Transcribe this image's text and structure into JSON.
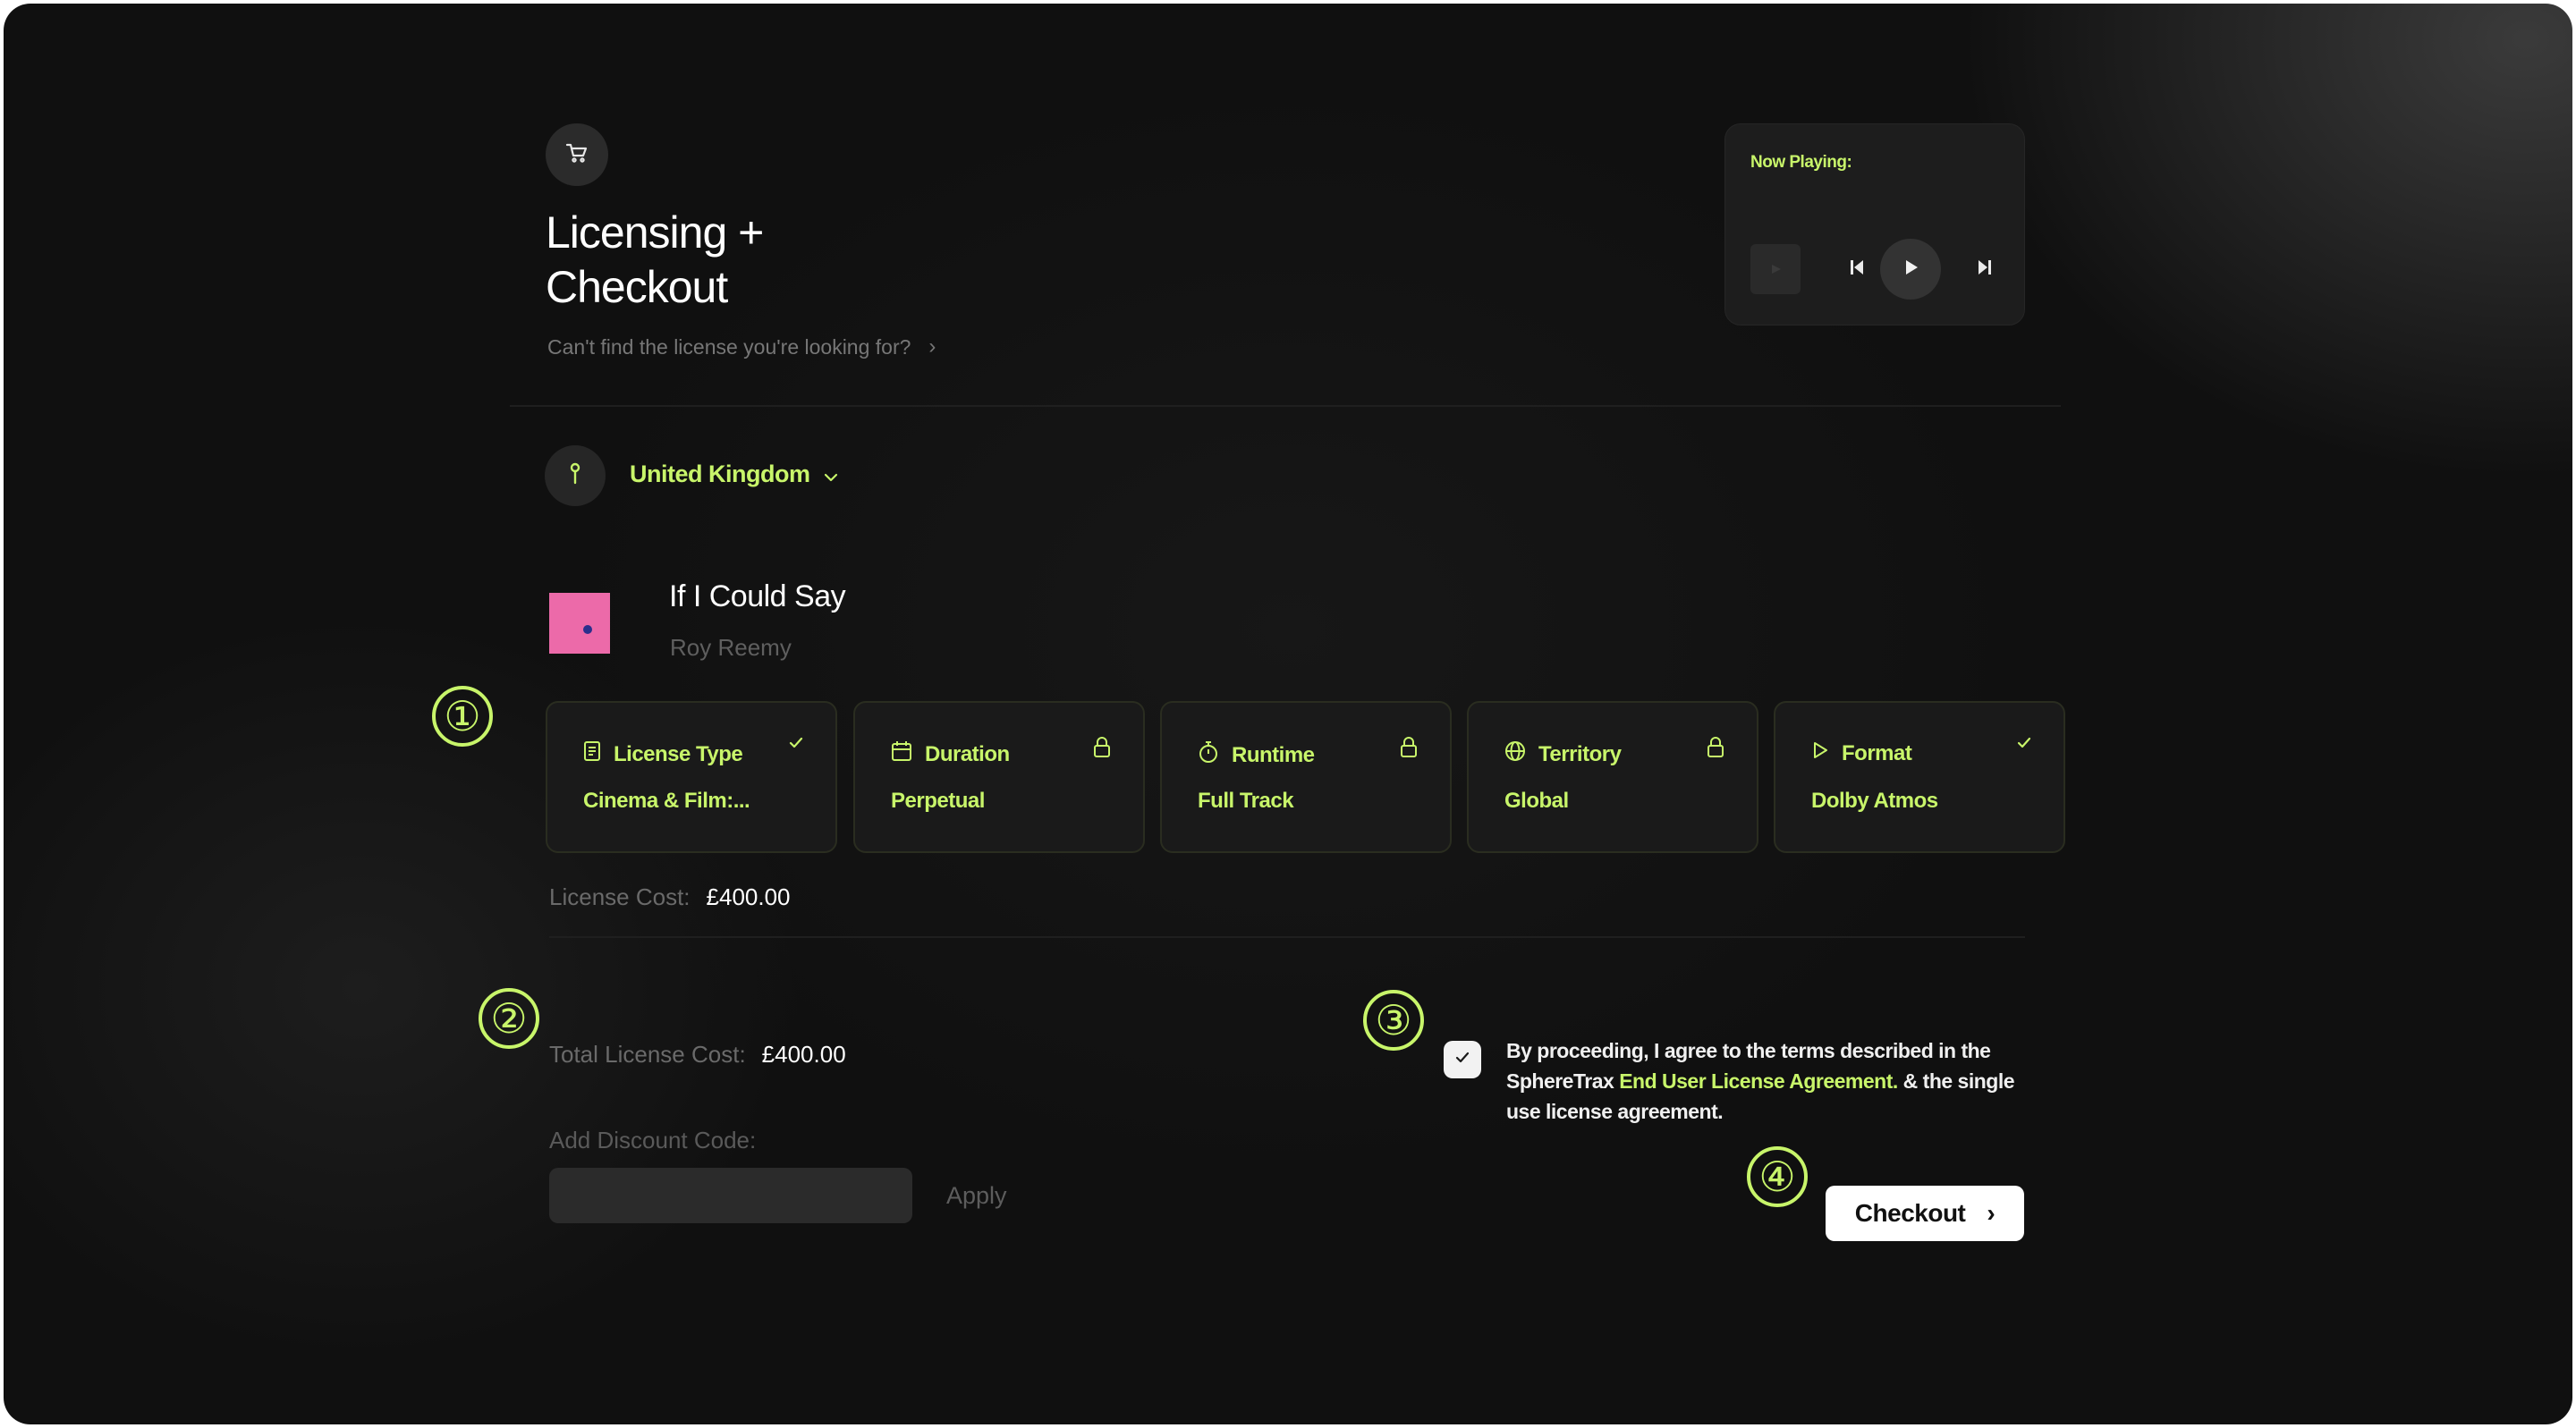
{
  "header": {
    "title_line1": "Licensing +",
    "title_line2": "Checkout",
    "subtitle": "Can't find the license you're looking for?",
    "subtitle_chevron": "›"
  },
  "player": {
    "label": "Now Playing:"
  },
  "location": {
    "country": "United Kingdom",
    "chevron": "⌄"
  },
  "track": {
    "title": "If I Could Say",
    "artist": "Roy Reemy"
  },
  "options": [
    {
      "label": "License Type",
      "value": "Cinema & Film:...",
      "icon": "document-icon",
      "status": "check"
    },
    {
      "label": "Duration",
      "value": "Perpetual",
      "icon": "calendar-icon",
      "status": "lock"
    },
    {
      "label": "Runtime",
      "value": "Full Track",
      "icon": "stopwatch-icon",
      "status": "lock"
    },
    {
      "label": "Territory",
      "value": "Global",
      "icon": "globe-icon",
      "status": "lock"
    },
    {
      "label": "Format",
      "value": "Dolby Atmos",
      "icon": "play-outline-icon",
      "status": "check"
    }
  ],
  "license_cost": {
    "label": "License Cost:",
    "value": "£400.00"
  },
  "total": {
    "label": "Total License Cost:",
    "value": "£400.00"
  },
  "discount": {
    "label": "Add Discount Code:",
    "placeholder": "",
    "apply_label": "Apply"
  },
  "agreement": {
    "text_before": "By proceeding, I agree to the terms described in the SphereTrax ",
    "link_text": "End User License Agreement.",
    "text_after": " & the single use license agreement.",
    "checked": true
  },
  "checkout": {
    "label": "Checkout",
    "chevron": "›"
  },
  "markers": [
    "①",
    "②",
    "③",
    "④"
  ],
  "colors": {
    "accent": "#c8f56a",
    "background": "#121212",
    "card_bg": "#1a1a1a",
    "album_art": "#ec6aa9"
  }
}
